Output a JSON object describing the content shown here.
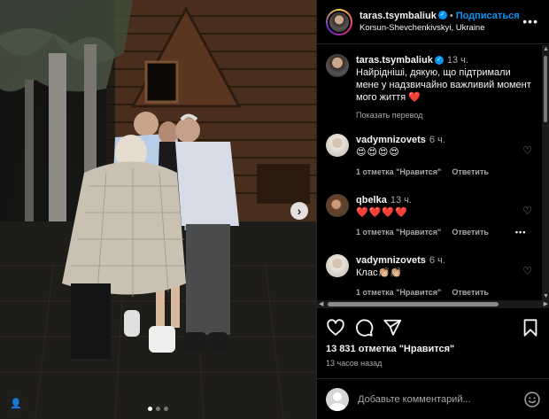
{
  "post": {
    "username": "taras.tsymbaliuk",
    "follow_label": "Подписаться",
    "location": "Korsun-Shevchenkivskyi, Ukraine",
    "caption_username": "taras.tsymbaliuk",
    "caption_time": "13 ч.",
    "caption_text": "Найрідніші, дякую, що підтримали мене у надзвичайно важливий момент мого життя ❤️",
    "translate_label": "Показать перевод",
    "likes": "13 831 отметка \"Нравится\"",
    "time_ago": "13 часов назад",
    "comment_placeholder": "Добавьте комментарий..."
  },
  "comments": [
    {
      "username": "vadymnizovets",
      "time": "6 ч.",
      "text": "😍😍😍😍",
      "likes": "1 отметка \"Нравится\"",
      "reply": "Ответить"
    },
    {
      "username": "qbelka",
      "time": "13 ч.",
      "text": "❤️❤️❤️❤️",
      "likes": "1 отметка \"Нравится\"",
      "reply": "Ответить"
    },
    {
      "username": "vadymnizovets",
      "time": "6 ч.",
      "text": "Клас👏🏼👏🏼",
      "likes": "1 отметка \"Нравится\"",
      "reply": "Ответить"
    }
  ],
  "photo": {
    "slides": 3,
    "active_slide": 1
  },
  "colors": {
    "accent": "#0095f6",
    "background": "#000000",
    "secondary_text": "#a8a8a8",
    "heart": "#ff3040"
  },
  "icons": [
    "verified-icon",
    "more-icon",
    "heart-icon",
    "comment-icon",
    "share-icon",
    "save-icon",
    "emoji-icon",
    "next-arrow-icon",
    "user-tag-icon"
  ]
}
